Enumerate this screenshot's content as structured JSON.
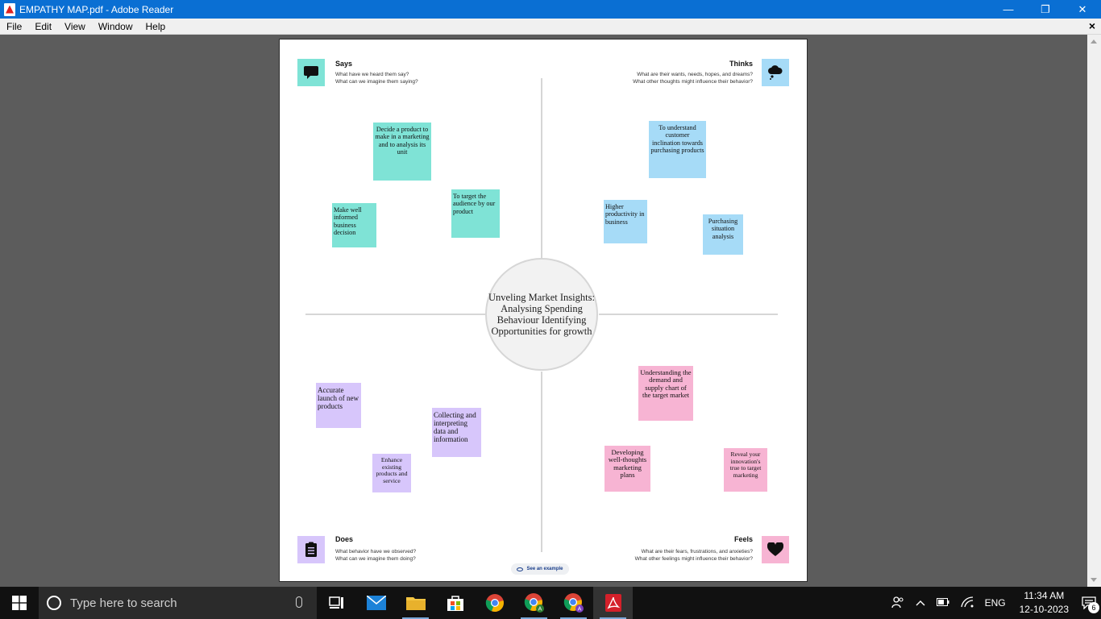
{
  "window": {
    "title": "EMPATHY MAP.pdf - Adobe Reader",
    "minimize": "—",
    "restore": "❐",
    "close": "✕"
  },
  "menu": {
    "items": [
      "File",
      "Edit",
      "View",
      "Window",
      "Help"
    ],
    "doc_close": "×"
  },
  "map": {
    "center": "Unveling Market Insights: Analysing Spending Behaviour Identifying Opportunities for growth",
    "says": {
      "title": "Says",
      "sub1": "What have we heard them say?",
      "sub2": "What can we imagine them saying?",
      "notes": [
        "Decide a product to make in a marketing and to analysis its unit",
        "To target the audience by our product",
        "Make well informed business decision"
      ]
    },
    "thinks": {
      "title": "Thinks",
      "sub1": "What are their wants, needs, hopes, and dreams?",
      "sub2": "What other thoughts might influence their behavior?",
      "notes": [
        "To understand customer inclination towards purchasing products",
        "Higher productivity in business",
        "Purchasing situation analysis"
      ]
    },
    "does": {
      "title": "Does",
      "sub1": "What behavior have we observed?",
      "sub2": "What can we imagine them doing?",
      "notes": [
        "Accurate launch of new products",
        "Collecting and interpreting data and information",
        "Enhance existing products and service"
      ]
    },
    "feels": {
      "title": "Feels",
      "sub1": "What are their fears, frustrations, and anxieties?",
      "sub2": "What other feelings might influence their behavior?",
      "notes": [
        "Understanding the demand and supply chart of the target market",
        "Developing well-thoughts marketing plans",
        "Reveal your innovation's true to target marketing"
      ]
    },
    "see_example": "See an example"
  },
  "taskbar": {
    "search_placeholder": "Type here to search",
    "lang": "ENG",
    "time": "11:34 AM",
    "date": "12-10-2023",
    "notification_count": "6"
  },
  "colors": {
    "titlebar": "#0a6fd3",
    "teal": "#7fe3d6",
    "blue": "#a6dbf7",
    "violet": "#d7c6fb",
    "pink": "#f7b4d3"
  }
}
